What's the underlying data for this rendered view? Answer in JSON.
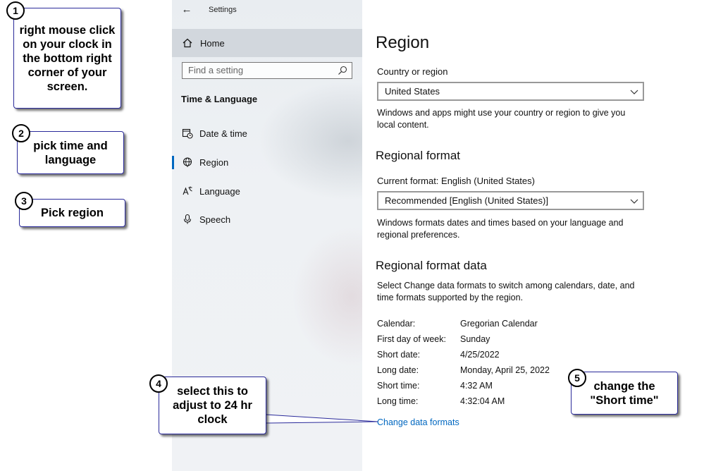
{
  "window": {
    "title": "Settings"
  },
  "sidebar": {
    "home_label": "Home",
    "search_placeholder": "Find a setting",
    "section_title": "Time & Language",
    "items": [
      {
        "label": "Date & time",
        "icon": "clock-calendar-icon",
        "selected": false
      },
      {
        "label": "Region",
        "icon": "globe-icon",
        "selected": true
      },
      {
        "label": "Language",
        "icon": "language-icon",
        "selected": false
      },
      {
        "label": "Speech",
        "icon": "microphone-icon",
        "selected": false
      }
    ]
  },
  "main": {
    "title": "Region",
    "country": {
      "label": "Country or region",
      "value": "United States",
      "description": "Windows and apps might use your country or region to give you local content."
    },
    "regional_format": {
      "heading": "Regional format",
      "current_label": "Current format: English (United States)",
      "value": "Recommended [English (United States)]",
      "description": "Windows formats dates and times based on your language and regional preferences."
    },
    "format_data": {
      "heading": "Regional format data",
      "description": "Select Change data formats to switch among calendars, date, and time formats supported by the region.",
      "rows": [
        {
          "key": "Calendar:",
          "value": "Gregorian Calendar"
        },
        {
          "key": "First day of week:",
          "value": "Sunday"
        },
        {
          "key": "Short date:",
          "value": "4/25/2022"
        },
        {
          "key": "Long date:",
          "value": "Monday, April 25, 2022"
        },
        {
          "key": "Short time:",
          "value": "4:32 AM"
        },
        {
          "key": "Long time:",
          "value": "4:32:04 AM"
        }
      ],
      "link": "Change data formats"
    }
  },
  "callouts": [
    {
      "number": "1",
      "text": "right mouse click on your clock in the bottom right corner of your screen."
    },
    {
      "number": "2",
      "text": "pick time and language"
    },
    {
      "number": "3",
      "text": "Pick region"
    },
    {
      "number": "4",
      "text": "select this to adjust to 24 hr clock"
    },
    {
      "number": "5",
      "text": "change the \"Short time\""
    }
  ],
  "colors": {
    "accent": "#0067c0",
    "callout_border": "#2a2a9a"
  }
}
